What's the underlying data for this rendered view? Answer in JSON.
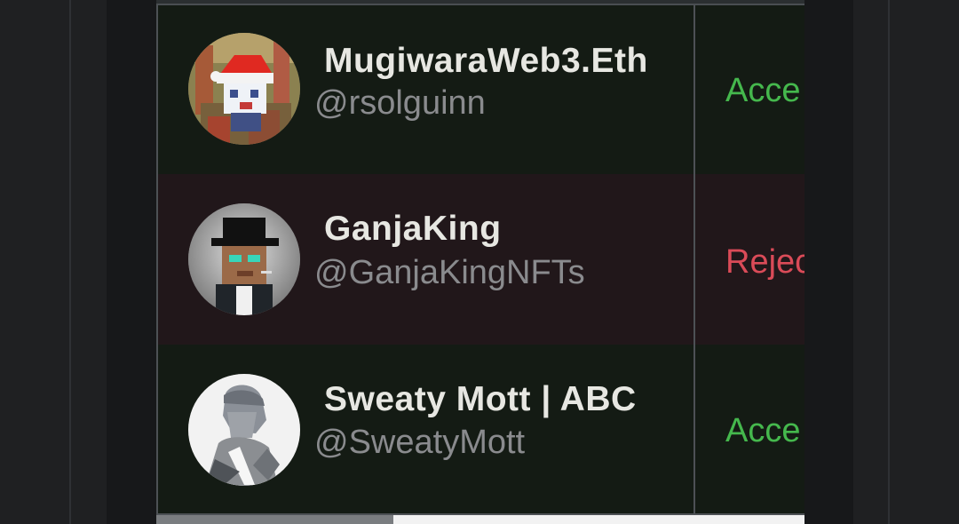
{
  "rows": [
    {
      "name": "MugiwaraWeb3.Eth",
      "handle": "@rsolguinn",
      "status": "Acce",
      "status_type": "accepted",
      "avatar_icon": "santa-hat-avatar-icon",
      "accent": "#45b84d"
    },
    {
      "name": "GanjaKing",
      "handle": "@GanjaKingNFTs",
      "status": "Rejec",
      "status_type": "rejected",
      "avatar_icon": "fedora-avatar-icon",
      "accent": "#da4b58"
    },
    {
      "name": "Sweaty Mott | ABC",
      "handle": "@SweatyMott",
      "status": "Acce",
      "status_type": "accepted",
      "avatar_icon": "sketch-avatar-icon",
      "accent": "#45b84d"
    }
  ],
  "scroll": {
    "position_fraction": 0.37
  }
}
